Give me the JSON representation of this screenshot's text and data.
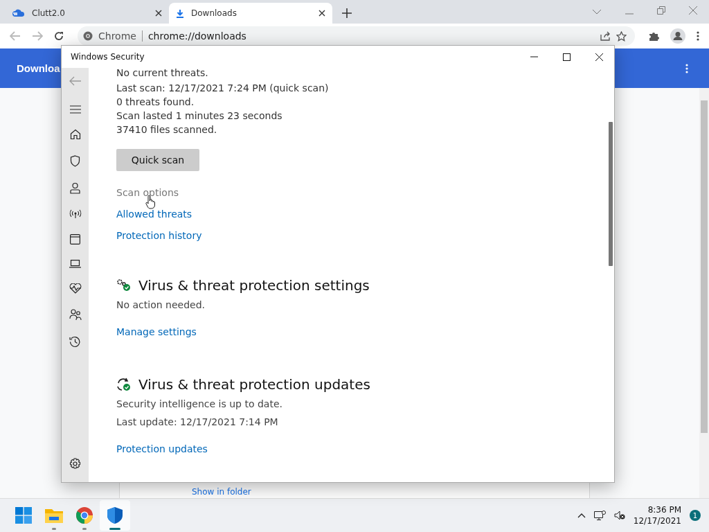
{
  "browser": {
    "tabs": [
      {
        "title": "Clutt2.0",
        "kind": "cloud",
        "selected": false
      },
      {
        "title": "Downloads",
        "kind": "download",
        "selected": true
      }
    ],
    "address": {
      "site_label": "Chrome",
      "url": "chrome://downloads"
    },
    "page": {
      "header_title": "Downloa",
      "partial_link": "Show in folder"
    }
  },
  "dialog": {
    "title": "Windows Security",
    "status_lines": [
      "No current threats.",
      "Last scan: 12/17/2021 7:24 PM (quick scan)",
      "0 threats found.",
      "Scan lasted 1 minutes 23 seconds",
      "37410 files scanned."
    ],
    "scan_button": "Quick scan",
    "links": [
      {
        "label": "Scan options",
        "hovered": true
      },
      {
        "label": "Allowed threats",
        "hovered": false
      },
      {
        "label": "Protection history",
        "hovered": false
      }
    ],
    "sections": [
      {
        "kind": "settings",
        "heading": "Virus & threat protection settings",
        "lines": [
          "No action needed."
        ],
        "link": "Manage settings"
      },
      {
        "kind": "updates",
        "heading": "Virus & threat protection updates",
        "lines": [
          "Security intelligence is up to date.",
          "Last update: 12/17/2021 7:14 PM"
        ],
        "link": "Protection updates"
      }
    ]
  },
  "taskbar": {
    "apps": [
      {
        "kind": "start",
        "running": false,
        "active": false
      },
      {
        "kind": "folder",
        "running": true,
        "active": false
      },
      {
        "kind": "chrome",
        "running": true,
        "active": false
      },
      {
        "kind": "shield",
        "running": true,
        "active": true
      }
    ],
    "time": "8:36 PM",
    "date": "12/17/2021",
    "notification_count": "1"
  }
}
